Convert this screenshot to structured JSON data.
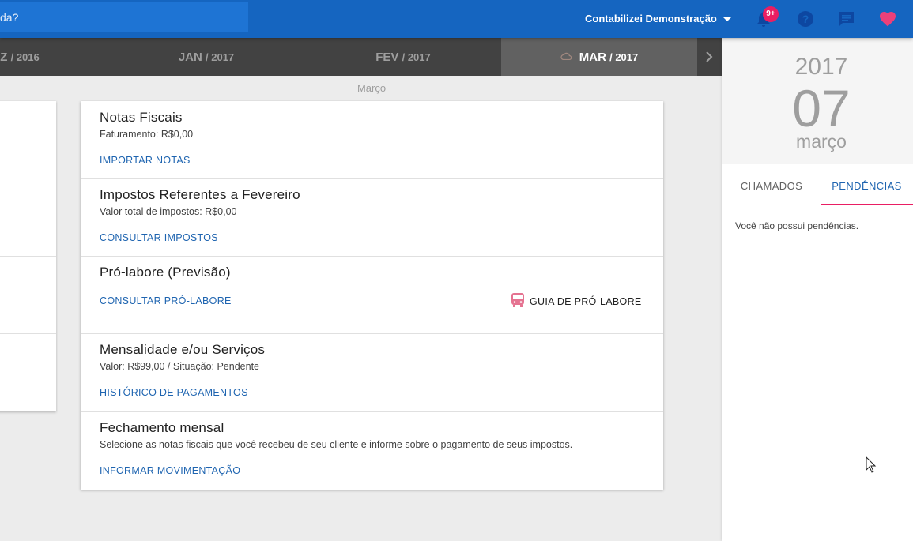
{
  "topbar": {
    "help_search_text": "da?",
    "account_name": "Contabilizei Demonstração",
    "notification_badge": "9+",
    "icons": [
      "bell-icon",
      "help-icon",
      "chat-icon",
      "heart-icon"
    ]
  },
  "months": [
    {
      "name": "Z",
      "year": "/ 2016"
    },
    {
      "name": "JAN",
      "year": "/ 2017"
    },
    {
      "name": "FEV",
      "year": "/ 2017"
    },
    {
      "name": "MAR",
      "year": "/ 2017",
      "active": true
    }
  ],
  "section_label": "Março",
  "items": [
    {
      "title": "Notas Fiscais",
      "subtitle": "Faturamento: R$0,00",
      "action": "IMPORTAR NOTAS"
    },
    {
      "title": "Impostos Referentes a Fevereiro",
      "subtitle": "Valor total de impostos: R$0,00",
      "action": "CONSULTAR IMPOSTOS"
    },
    {
      "title": "Pró-labore (Previsão)",
      "action": "CONSULTAR PRÓ-LABORE",
      "secondary_action": "GUIA DE PRÓ-LABORE"
    },
    {
      "title": "Mensalidade e/ou Serviços",
      "subtitle": "Valor: R$99,00 / Situação: Pendente",
      "action": "HISTÓRICO DE PAGAMENTOS"
    },
    {
      "title": "Fechamento mensal",
      "subtitle": "Selecione as notas fiscais que você recebeu de seu cliente e informe sobre o pagamento de seus impostos.",
      "action": "INFORMAR MOVIMENTAÇÃO"
    }
  ],
  "date_panel": {
    "year": "2017",
    "day": "07",
    "month": "março"
  },
  "tabs": [
    {
      "label": "CHAMADOS"
    },
    {
      "label": "PENDÊNCIAS",
      "active": true
    }
  ],
  "empty_message": "Você não possui pendências.",
  "colors": {
    "topbar": "#1565c0",
    "accent": "#e91e63",
    "link": "#1e64b0",
    "month_bar": "#424242"
  }
}
